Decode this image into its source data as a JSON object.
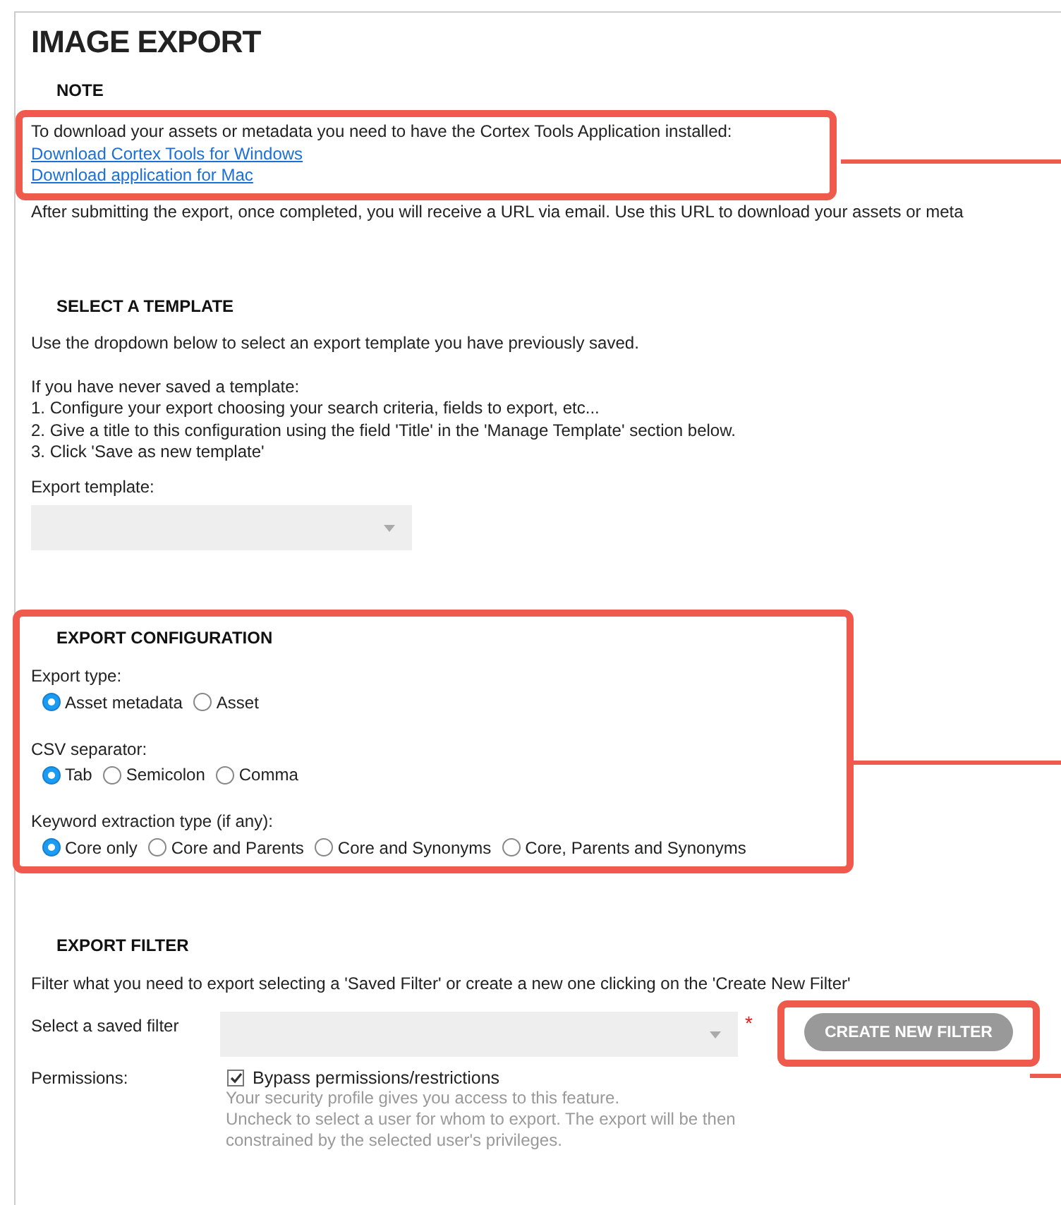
{
  "title": "IMAGE EXPORT",
  "note": {
    "heading": "NOTE",
    "highlighted": true,
    "text": "To download your assets or metadata you need to have the Cortex Tools Application installed:",
    "links": [
      "Download Cortex Tools for Windows",
      "Download application for Mac"
    ],
    "after": "After submitting the export, once completed, you will receive a URL via email. Use this URL to download your assets or meta"
  },
  "template": {
    "heading": "SELECT A TEMPLATE",
    "intro": "Use the dropdown below to select an export template you have previously saved.",
    "lines": [
      "If you have never saved a template:",
      "1. Configure your export choosing your search criteria, fields to export, etc...",
      "2. Give a title to this configuration using the field 'Title' in the 'Manage Template' section below.",
      "3. Click 'Save as new template'"
    ],
    "field_label": "Export template:"
  },
  "configuration": {
    "heading": "EXPORT CONFIGURATION",
    "highlighted": true,
    "groups": [
      {
        "label": "Export type:",
        "options": [
          {
            "label": "Asset metadata",
            "selected": true
          },
          {
            "label": "Asset",
            "selected": false
          }
        ]
      },
      {
        "label": "CSV separator:",
        "options": [
          {
            "label": "Tab",
            "selected": true
          },
          {
            "label": "Semicolon",
            "selected": false
          },
          {
            "label": "Comma",
            "selected": false
          }
        ]
      },
      {
        "label": "Keyword extraction type (if any):",
        "options": [
          {
            "label": "Core only",
            "selected": true
          },
          {
            "label": "Core and Parents",
            "selected": false
          },
          {
            "label": "Core and Synonyms",
            "selected": false
          },
          {
            "label": "Core, Parents and Synonyms",
            "selected": false
          }
        ]
      }
    ]
  },
  "filter": {
    "heading": "EXPORT FILTER",
    "intro": "Filter what you need to export selecting a 'Saved Filter' or create a new one clicking on the 'Create New Filter'",
    "select_label": "Select a saved filter",
    "required_mark": "*",
    "button": "CREATE NEW FILTER",
    "button_highlighted": true,
    "permissions_label": "Permissions:",
    "bypass": {
      "label": "Bypass permissions/restrictions",
      "checked": true
    },
    "hint": [
      "Your security profile gives you access to this feature.",
      "Uncheck to select a user for whom to export. The export will be then",
      "constrained by the selected user's privileges."
    ]
  }
}
